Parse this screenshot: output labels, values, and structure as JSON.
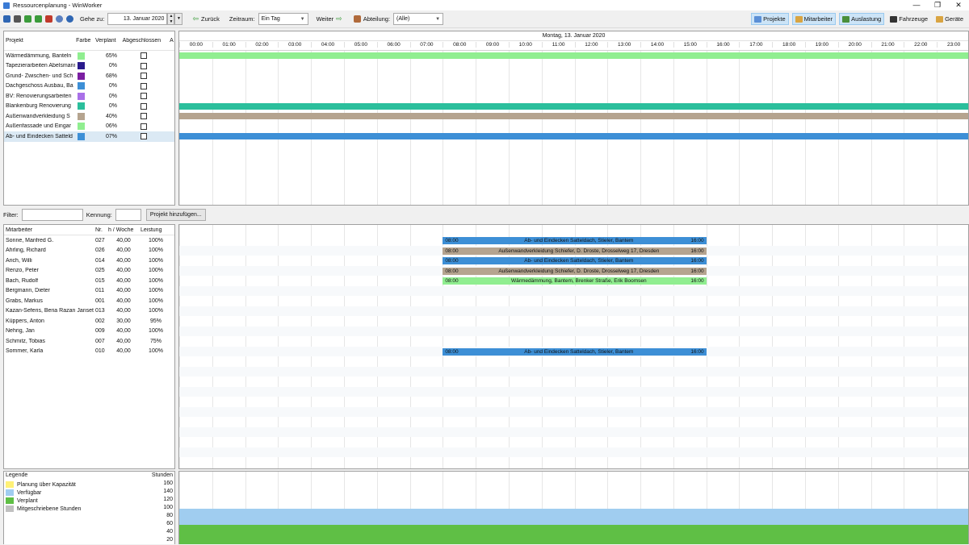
{
  "window": {
    "title": "Ressourcenplanung - WinWorker",
    "controls": [
      "—",
      "❐",
      "✕"
    ]
  },
  "toolbar": {
    "goto_label": "Gehe zu:",
    "date_value": "13. Januar 2020",
    "back_label": "Zurück",
    "range_label": "Zeitraum:",
    "range_value": "Ein Tag",
    "forward_label": "Weiter",
    "department_label": "Abteilung:",
    "department_value": "(Alle)",
    "views": {
      "projekte": "Projekte",
      "mitarbeiter": "Mitarbeiter",
      "auslastung": "Auslastung",
      "fahrzeuge": "Fahrzeuge",
      "geraete": "Geräte"
    },
    "icon_colors": [
      "#2f66b3",
      "#555555",
      "#3b9b3b",
      "#3b9b3b",
      "#c0392b",
      "#5b7fbf",
      "#2f66b3"
    ]
  },
  "projects": {
    "headers": {
      "name": "Projekt",
      "color": "Farbe",
      "planned": "Verplant",
      "closed": "Abgeschlossen",
      "extra": "A"
    },
    "rows": [
      {
        "name": "Wärmedämmung, Banteln",
        "color": "#90ee90",
        "planned": "65%"
      },
      {
        "name": "Tapezierarbeiten Abelsmann",
        "color": "#2a1a8c",
        "planned": "0%"
      },
      {
        "name": "Grund- Zwischen- und Sch",
        "color": "#7b1fa2",
        "planned": "68%"
      },
      {
        "name": "Dachgeschoss Ausbau, Ba",
        "color": "#3d8fd6",
        "planned": "0%"
      },
      {
        "name": "BV: Renovierungsarbeiten",
        "color": "#a970e8",
        "planned": "0%"
      },
      {
        "name": "Blankenburg Renovierung",
        "color": "#2bbf9c",
        "planned": "0%"
      },
      {
        "name": "Außenwandverkleidung S",
        "color": "#b5a48f",
        "planned": "40%"
      },
      {
        "name": "Außenfassade und Eingar",
        "color": "#90ee90",
        "planned": "06%"
      },
      {
        "name": "Ab- und Eindecken Satteld",
        "color": "#3d8fd6",
        "planned": "07%"
      }
    ]
  },
  "timeline": {
    "date_header": "Montag, 13. Januar 2020",
    "hours": [
      "00:00",
      "01:00",
      "02:00",
      "03:00",
      "04:00",
      "05:00",
      "06:00",
      "07:00",
      "08:00",
      "09:00",
      "10:00",
      "11:00",
      "12:00",
      "13:00",
      "14:00",
      "15:00",
      "16:00",
      "17:00",
      "18:00",
      "19:00",
      "20:00",
      "21:00",
      "22:00",
      "23:00"
    ]
  },
  "project_bars": [
    {
      "row": 0,
      "color": "#90ee90"
    },
    {
      "row": 5,
      "color": "#2bbf9c"
    },
    {
      "row": 6,
      "color": "#b5a48f"
    },
    {
      "row": 8,
      "color": "#3d8fd6"
    }
  ],
  "filter": {
    "filter_label": "Filter:",
    "filter_value": "",
    "code_label": "Kennung:",
    "code_value": "",
    "add_button": "Projekt hinzufügen..."
  },
  "employees": {
    "headers": {
      "name": "Mitarbeiter",
      "nr": "Nr.",
      "hours": "h / Woche",
      "perf": "Leistung"
    },
    "rows": [
      {
        "name": "Sonne, Manfred G.",
        "nr": "027",
        "hours": "40,00",
        "perf": "100%"
      },
      {
        "name": "Ahrling, Richard",
        "nr": "026",
        "hours": "40,00",
        "perf": "100%"
      },
      {
        "name": "Arich, Willi",
        "nr": "014",
        "hours": "40,00",
        "perf": "100%"
      },
      {
        "name": "Renzo, Peter",
        "nr": "025",
        "hours": "40,00",
        "perf": "100%"
      },
      {
        "name": "Bach, Rudolf",
        "nr": "015",
        "hours": "40,00",
        "perf": "100%"
      },
      {
        "name": "Bergmann, Dieter",
        "nr": "011",
        "hours": "40,00",
        "perf": "100%"
      },
      {
        "name": "Grabs, Markus",
        "nr": "001",
        "hours": "40,00",
        "perf": "100%"
      },
      {
        "name": "Kazan-Seferis, Beria Razan Janset",
        "nr": "013",
        "hours": "40,00",
        "perf": "100%"
      },
      {
        "name": "Küppers, Anton",
        "nr": "002",
        "hours": "30,00",
        "perf": "95%"
      },
      {
        "name": "Nehrig, Jan",
        "nr": "009",
        "hours": "40,00",
        "perf": "100%"
      },
      {
        "name": "Schmitz, Tobias",
        "nr": "007",
        "hours": "40,00",
        "perf": "75%"
      },
      {
        "name": "Sommer, Karla",
        "nr": "010",
        "hours": "40,00",
        "perf": "100%"
      }
    ]
  },
  "assignments": [
    {
      "row": 0,
      "start": "08:00",
      "end": "16:00",
      "text": "Ab- und Eindecken Satteldach, Stieler, Bantem",
      "color": "#3d8fd6"
    },
    {
      "row": 1,
      "start": "08:00",
      "end": "16:00",
      "text": "Außenwandverkleidung Schiefer, D. Droste, Drosselweg 17, Dresden",
      "color": "#b5a48f"
    },
    {
      "row": 2,
      "start": "08:00",
      "end": "16:00",
      "text": "Ab- und Eindecken Satteldach, Stieler, Bantem",
      "color": "#3d8fd6"
    },
    {
      "row": 3,
      "start": "08:00",
      "end": "16:00",
      "text": "Außenwandverkleidung Schiefer, D. Droste, Drosselweg 17, Dresden",
      "color": "#b5a48f"
    },
    {
      "row": 4,
      "start": "08:00",
      "end": "16:00",
      "text": "Wärmedämmung, Bantem, Brenker Straße, Erik Boomsen",
      "color": "#90ee90"
    },
    {
      "row": 11,
      "start": "08:00",
      "end": "16:00",
      "text": "Ab- und Eindecken Satteldach, Stieler, Bantem",
      "color": "#3d8fd6"
    }
  ],
  "legend": {
    "title": "Legende",
    "hours_label": "Stunden",
    "items": [
      {
        "label": "Planung über Kapazität",
        "color": "#fff176"
      },
      {
        "label": "Verfügbar",
        "color": "#a0cdf0"
      },
      {
        "label": "Verplant",
        "color": "#5fbf45"
      },
      {
        "label": "Mitgeschriebene Stunden",
        "color": "#c0c0c0"
      }
    ],
    "scale": [
      "160",
      "140",
      "120",
      "100",
      "80",
      "60",
      "40",
      "20"
    ]
  },
  "capacity": {
    "available_hours": 100,
    "planned_hours": 60,
    "available_color": "#a0cdf0",
    "planned_color": "#5fbf45"
  }
}
